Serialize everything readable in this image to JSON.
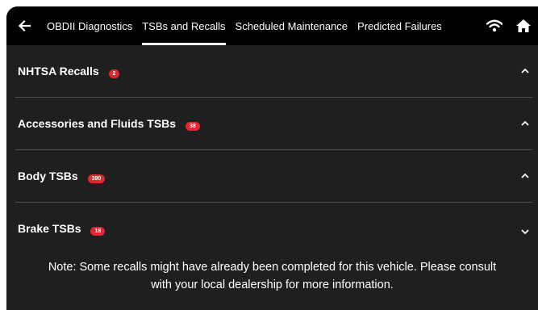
{
  "nav": {
    "tabs": [
      {
        "label": "OBDII Diagnostics"
      },
      {
        "label": "TSBs and Recalls"
      },
      {
        "label": "Scheduled Maintenance"
      },
      {
        "label": "Predicted Failures"
      }
    ],
    "active_tab": "TSBs and Recalls",
    "icons": [
      "back-arrow-icon",
      "wifi-icon",
      "home-icon"
    ]
  },
  "sections": [
    {
      "title": "NHTSA Recalls",
      "count": "2",
      "state": "expanded"
    },
    {
      "title": "Accessories and Fluids TSBs",
      "count": "38",
      "state": "expanded"
    },
    {
      "title": "Body TSBs",
      "count": "390",
      "state": "expanded"
    },
    {
      "title": "Brake TSBs",
      "count": "18",
      "state": "collapsed"
    }
  ],
  "note": {
    "line1": "Note: Some recalls might have already been completed for this vehicle. Please consult",
    "line2": "with your local dealership for more information."
  },
  "colors": {
    "background": "#1f1f1f",
    "topbar": "#000000",
    "badge": "#e3262f",
    "divider": "#4d4d4d"
  }
}
